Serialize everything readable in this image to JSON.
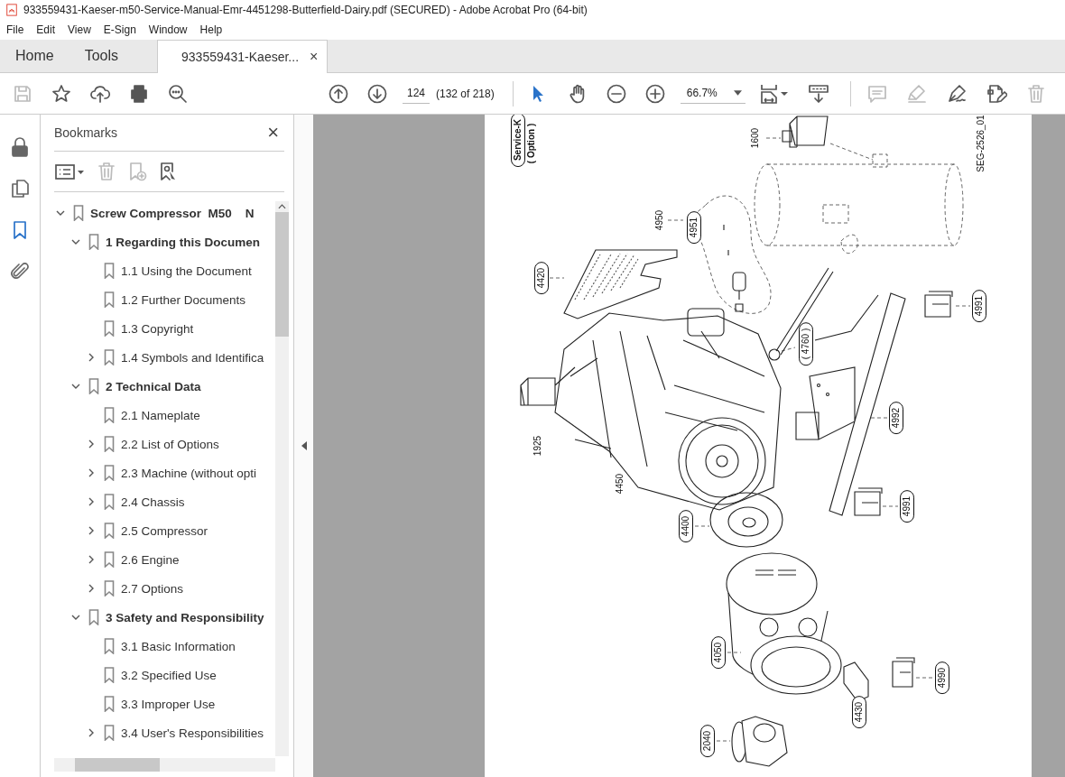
{
  "window": {
    "title": "933559431-Kaeser-m50-Service-Manual-Emr-4451298-Butterfield-Dairy.pdf (SECURED) - Adobe Acrobat Pro (64-bit)"
  },
  "menu": [
    "File",
    "Edit",
    "View",
    "E-Sign",
    "Window",
    "Help"
  ],
  "tabs": [
    {
      "label": "Home",
      "selected": false
    },
    {
      "label": "Tools",
      "selected": false
    },
    {
      "label": "933559431-Kaeser...",
      "selected": true,
      "close": "×"
    }
  ],
  "toolbar": {
    "file_actions": [
      {
        "kind": "save",
        "disabled": true
      },
      {
        "kind": "star",
        "disabled": false
      },
      {
        "kind": "upload",
        "disabled": false
      },
      {
        "kind": "print",
        "disabled": false
      },
      {
        "kind": "find",
        "disabled": false
      }
    ],
    "navigation": [
      {
        "kind": "up"
      },
      {
        "kind": "down"
      }
    ],
    "page_field": "124",
    "page_count": "(132 of 218)",
    "tools": [
      {
        "kind": "select",
        "selected": true
      },
      {
        "kind": "hand",
        "selected": false
      }
    ],
    "zoom_buttons": [
      {
        "kind": "zoom-out"
      },
      {
        "kind": "zoom-in"
      }
    ],
    "zoom_field": "66.7%",
    "edit_actions": [
      {
        "kind": "comment",
        "disabled": true
      },
      {
        "kind": "highlight",
        "disabled": true
      },
      {
        "kind": "sign",
        "disabled": false
      },
      {
        "kind": "edit",
        "disabled": false
      },
      {
        "kind": "delete",
        "disabled": true
      }
    ]
  },
  "rail": [
    {
      "kind": "lock",
      "selected": false
    },
    {
      "kind": "pages",
      "selected": false
    },
    {
      "kind": "bookmark",
      "selected": true
    },
    {
      "kind": "attachment",
      "selected": false
    }
  ],
  "bookmarks": {
    "title": "Bookmarks",
    "close": "×",
    "tools": [
      {
        "kind": "options",
        "disabled": false
      },
      {
        "kind": "delete",
        "disabled": true
      },
      {
        "kind": "add",
        "disabled": true
      },
      {
        "kind": "find",
        "disabled": false
      }
    ],
    "items": [
      {
        "label": "Screw Compressor  M50    N",
        "expanded": true,
        "children": [
          {
            "label": "1 Regarding this Documen",
            "expanded": true,
            "children": [
              {
                "label": "1.1 Using the Document"
              },
              {
                "label": "1.2 Further Documents"
              },
              {
                "label": "1.3 Copyright"
              },
              {
                "label": "1.4 Symbols and Identifica",
                "expanded": false
              }
            ]
          },
          {
            "label": "2 Technical Data",
            "expanded": true,
            "children": [
              {
                "label": "2.1 Nameplate"
              },
              {
                "label": "2.2 List of Options",
                "expanded": false
              },
              {
                "label": "2.3 Machine (without opti",
                "expanded": false
              },
              {
                "label": "2.4 Chassis",
                "expanded": false
              },
              {
                "label": "2.5 Compressor",
                "expanded": false
              },
              {
                "label": "2.6 Engine",
                "expanded": false
              },
              {
                "label": "2.7 Options",
                "expanded": false
              }
            ]
          },
          {
            "label": "3 Safety and Responsibility",
            "expanded": true,
            "children": [
              {
                "label": "3.1 Basic Information"
              },
              {
                "label": "3.2 Specified Use"
              },
              {
                "label": "3.3 Improper Use"
              },
              {
                "label": "3.4 User's Responsibilities",
                "expanded": false
              }
            ]
          }
        ]
      }
    ]
  },
  "page": {
    "header_tab": "Service-K",
    "header_note": "( Option )",
    "drawing_code": "SEG-2526_01",
    "callouts": [
      {
        "text": "1600",
        "boxed": false
      },
      {
        "text": "4950",
        "boxed": false
      },
      {
        "text": "4951",
        "boxed": true
      },
      {
        "text": "4420",
        "boxed": true
      },
      {
        "text": "4991",
        "boxed": true
      },
      {
        "text": "( 4760 )",
        "boxed": true
      },
      {
        "text": "1925",
        "boxed": false
      },
      {
        "text": "4992",
        "boxed": true
      },
      {
        "text": "4450",
        "boxed": false
      },
      {
        "text": "4991",
        "boxed": true
      },
      {
        "text": "4400",
        "boxed": true
      },
      {
        "text": "4050",
        "boxed": true
      },
      {
        "text": "4990",
        "boxed": true
      },
      {
        "text": "4430",
        "boxed": true
      },
      {
        "text": "2040",
        "boxed": true
      }
    ]
  }
}
